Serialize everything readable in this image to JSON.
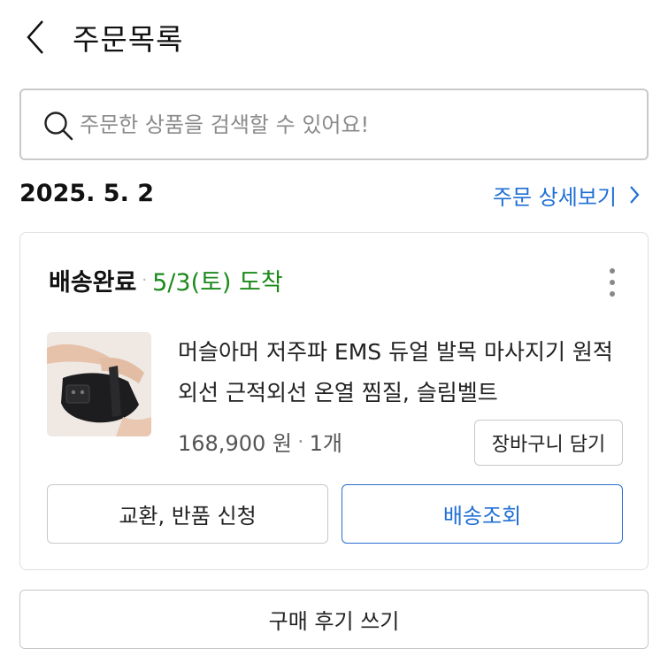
{
  "header": {
    "title": "주문목록",
    "back_icon": "chevron-left-icon"
  },
  "search": {
    "placeholder": "주문한 상품을 검색할 수 있어요!",
    "value": "",
    "icon": "search-icon"
  },
  "order_group": {
    "date": "2025. 5. 2",
    "detail_link": "주문 상세보기",
    "detail_icon": "chevron-right-icon"
  },
  "order": {
    "status": "배송완료",
    "status_separator": "·",
    "arrival": "5/3(토) 도착",
    "arrival_color": "#1c8a1c",
    "product_name": "머슬아머 저주파 EMS 듀얼 발목 마사지기 원적외선 근적외선 온열 찜질, 슬림벨트",
    "price": "168,900 원",
    "price_separator": "·",
    "quantity": "1개",
    "cart_button": "장바구니 담기",
    "exchange_button": "교환, 반품 신청",
    "tracking_button": "배송조회"
  },
  "review_button": "구매 후기 쓰기",
  "colors": {
    "accent": "#1f6fd4",
    "status_green": "#1c8a1c",
    "border": "#c8c8c8"
  }
}
